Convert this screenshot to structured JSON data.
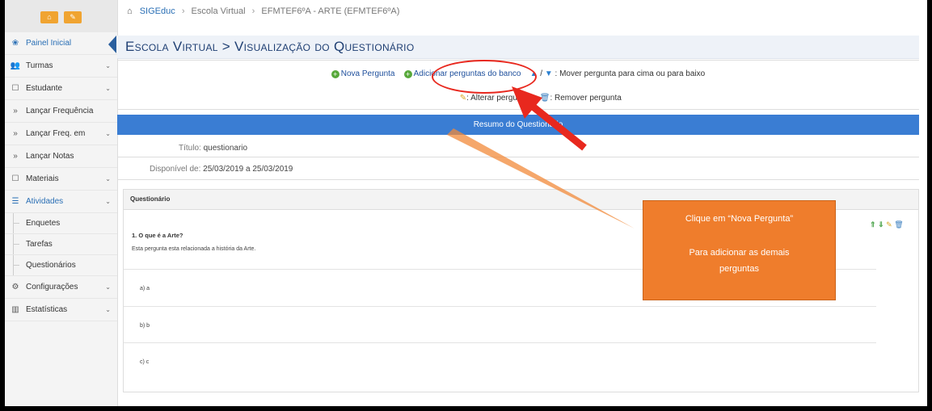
{
  "sidebar": {
    "top_icons": [
      "home-icon",
      "pencil-icon"
    ],
    "items": [
      {
        "label": "Painel Inicial",
        "icon": "dashboard-icon"
      },
      {
        "label": "Turmas",
        "icon": "users-icon"
      },
      {
        "label": "Estudante",
        "icon": "edit-icon"
      },
      {
        "label": "Lançar Frequência",
        "icon": "double-chevron-icon"
      },
      {
        "label": "Lançar Freq. em",
        "icon": "double-chevron-icon"
      },
      {
        "label": "Lançar Notas",
        "icon": "double-chevron-icon"
      },
      {
        "label": "Materiais",
        "icon": "edit-icon"
      },
      {
        "label": "Atividades",
        "icon": "list-icon"
      },
      {
        "label": "Configurações",
        "icon": "gears-icon"
      },
      {
        "label": "Estatísticas",
        "icon": "bar-chart-icon"
      }
    ],
    "subitems": [
      {
        "label": "Enquetes"
      },
      {
        "label": "Tarefas"
      },
      {
        "label": "Questionários"
      }
    ]
  },
  "breadcrumb": {
    "brand": "SIGEduc",
    "level2": "Escola Virtual",
    "level3": "EFMTEF6ºA - ARTE (EFMTEF6ºA)"
  },
  "page": {
    "title": "Escola Virtual > Visualização do Questionário"
  },
  "toolbar": {
    "nova_pergunta": "Nova Pergunta",
    "adicionar_banco": "Adicionar perguntas do banco",
    "mover_sep": "/",
    "mover_label": ": Mover pergunta para cima ou para baixo",
    "alterar_label": ": Alterar pergunta",
    "remover_label": ": Remover pergunta"
  },
  "resumo": {
    "header": "Resumo do Questionário",
    "titulo_label": "Título:",
    "titulo_value": "questionario",
    "disponivel_label": "Disponível de:",
    "disponivel_value": "25/03/2019 a 25/03/2019"
  },
  "questionario": {
    "header": "Questionário",
    "question_title": "1. O que é a Arte?",
    "question_desc": "Esta pergunta esta relacionada a história da Arte.",
    "options": [
      "a) a",
      "b) b",
      "c) c"
    ]
  },
  "annotation": {
    "line1": "Clique em “Nova Pergunta”",
    "line2": "Para adicionar as demais",
    "line3": "perguntas"
  },
  "colors": {
    "accent": "#3a7dd3",
    "sidebar_active": "#2a6fb5",
    "annotation_orange": "#ef7d2c",
    "annotation_red": "#e8281e"
  }
}
